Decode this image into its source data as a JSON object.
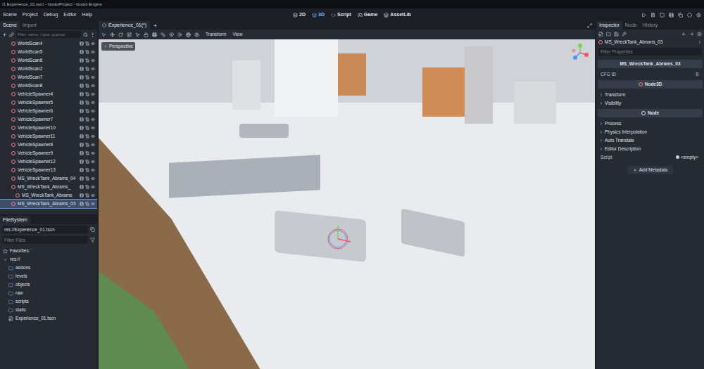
{
  "window": {
    "title": "/1 Experience_01.tscn - GodotProject - Godot Engine"
  },
  "menu": [
    "Scene",
    "Project",
    "Debug",
    "Editor",
    "Help"
  ],
  "workspaces": [
    {
      "label": "2D",
      "selected": false
    },
    {
      "label": "3D",
      "selected": true
    },
    {
      "label": "Script",
      "selected": false
    },
    {
      "label": "Game",
      "selected": false
    },
    {
      "label": "AssetLib",
      "selected": false
    }
  ],
  "scene_panel": {
    "tabs": [
      {
        "label": "Scene",
        "selected": true
      },
      {
        "label": "Import",
        "selected": false
      }
    ],
    "filter_placeholder": "Filter: name, t:type, g:group",
    "nodes": [
      {
        "name": "WorldScan4",
        "depth": 1,
        "expanded": false,
        "selected": false
      },
      {
        "name": "WorldScan5",
        "depth": 1,
        "expanded": false,
        "selected": false
      },
      {
        "name": "WorldScan6",
        "depth": 1,
        "expanded": false,
        "selected": false
      },
      {
        "name": "WorldScan2",
        "depth": 1,
        "expanded": false,
        "selected": false
      },
      {
        "name": "WorldScan7",
        "depth": 1,
        "expanded": false,
        "selected": false
      },
      {
        "name": "WorldScan8",
        "depth": 1,
        "expanded": false,
        "selected": false
      },
      {
        "name": "VehicleSpawner4",
        "depth": 1,
        "expanded": false,
        "selected": false
      },
      {
        "name": "VehicleSpawner5",
        "depth": 1,
        "expanded": false,
        "selected": false
      },
      {
        "name": "VehicleSpawner6",
        "depth": 1,
        "expanded": false,
        "selected": false
      },
      {
        "name": "VehicleSpawner7",
        "depth": 1,
        "expanded": false,
        "selected": false
      },
      {
        "name": "VehicleSpawner10",
        "depth": 1,
        "expanded": false,
        "selected": false
      },
      {
        "name": "VehicleSpawner11",
        "depth": 1,
        "expanded": false,
        "selected": false
      },
      {
        "name": "VehicleSpawner8",
        "depth": 1,
        "expanded": false,
        "selected": false
      },
      {
        "name": "VehicleSpawner9",
        "depth": 1,
        "expanded": false,
        "selected": false
      },
      {
        "name": "VehicleSpawner12",
        "depth": 1,
        "expanded": false,
        "selected": false
      },
      {
        "name": "VehicleSpawner13",
        "depth": 1,
        "expanded": false,
        "selected": false
      },
      {
        "name": "MS_WreckTank_Abrams_04",
        "depth": 1,
        "expanded": false,
        "selected": false
      },
      {
        "name": "MS_WreckTank_Abrams_",
        "depth": 1,
        "expanded": true,
        "selected": false
      },
      {
        "name": "MS_WreckTank_Abrams",
        "depth": 2,
        "expanded": false,
        "selected": false
      },
      {
        "name": "MS_WreckTank_Abrams_03",
        "depth": 1,
        "expanded": false,
        "selected": true
      }
    ]
  },
  "filesystem": {
    "title": "FileSystem",
    "path": "res://Experience_01.tscn",
    "filter_placeholder": "Filter Files",
    "items": [
      {
        "label": "Favorites:",
        "kind": "favorites"
      },
      {
        "label": "res://",
        "kind": "root"
      },
      {
        "label": "addons",
        "kind": "folder"
      },
      {
        "label": "levels",
        "kind": "folder"
      },
      {
        "label": "objects",
        "kind": "folder"
      },
      {
        "label": "raw",
        "kind": "folder"
      },
      {
        "label": "scripts",
        "kind": "folder"
      },
      {
        "label": "static",
        "kind": "folder"
      },
      {
        "label": "Experience_01.tscn",
        "kind": "scene"
      }
    ]
  },
  "editor": {
    "tabs": [
      {
        "label": "Experience_01(*)",
        "selected": true
      }
    ],
    "toolbar_menus": [
      "Transform",
      "View"
    ],
    "viewport": {
      "label": "Perspective"
    }
  },
  "inspector": {
    "tabs": [
      {
        "label": "Inspector",
        "selected": true
      },
      {
        "label": "Node",
        "selected": false
      },
      {
        "label": "History",
        "selected": false
      }
    ],
    "object": "MS_WreckTank_Abrams_03",
    "filter_placeholder": "Filter Properties",
    "sections": [
      {
        "kind": "class",
        "label": "MS_WreckTank_Abrams_03"
      },
      {
        "kind": "property",
        "label": "CFG ID",
        "value": "0"
      },
      {
        "kind": "class",
        "label": "Node3D"
      },
      {
        "kind": "group",
        "label": "Transform"
      },
      {
        "kind": "group",
        "label": "Visibility"
      },
      {
        "kind": "class",
        "label": "Node"
      },
      {
        "kind": "group",
        "label": "Process"
      },
      {
        "kind": "group",
        "label": "Physics Interpolation"
      },
      {
        "kind": "group",
        "label": "Auto Translate"
      },
      {
        "kind": "group",
        "label": "Editor Description"
      },
      {
        "kind": "property",
        "label": "Script",
        "value": "<empty>"
      }
    ],
    "add_metadata": "Add Metadata"
  }
}
